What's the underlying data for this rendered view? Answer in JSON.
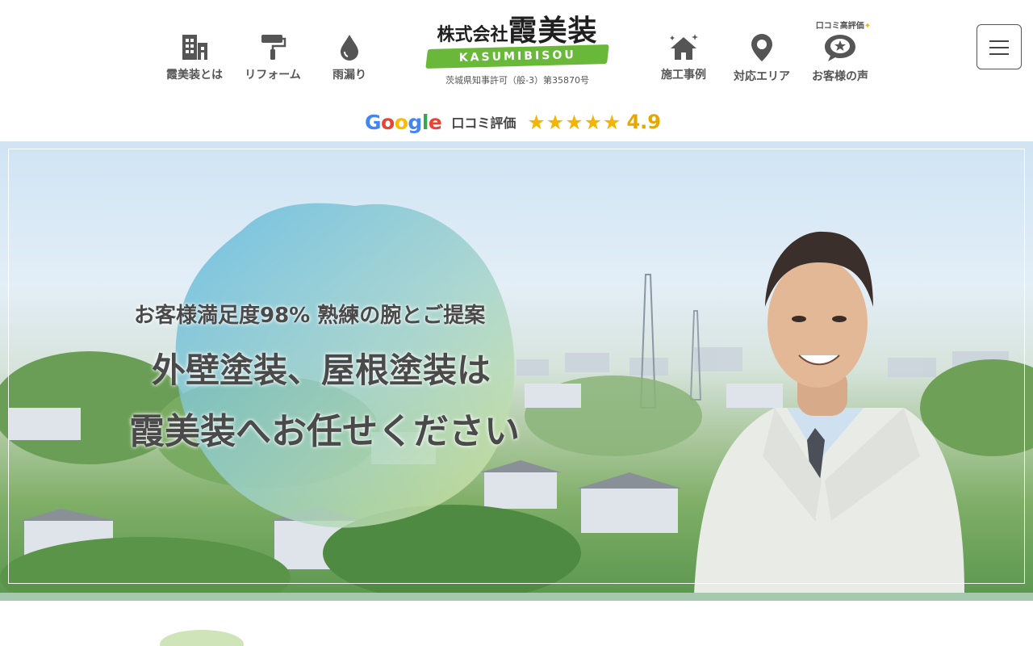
{
  "nav_left": [
    {
      "label": "霞美装とは",
      "icon": "building-icon"
    },
    {
      "label": "リフォーム",
      "icon": "paint-roller-icon"
    },
    {
      "label": "雨漏り",
      "icon": "water-drop-icon"
    }
  ],
  "nav_right": [
    {
      "label": "施工事例",
      "icon": "house-sparkle-icon"
    },
    {
      "label": "対応エリア",
      "icon": "map-pin-icon"
    },
    {
      "label": "お客様の声",
      "icon": "speech-bubble-star-icon"
    }
  ],
  "review_tag": "口コミ高評価",
  "logo": {
    "prefix": "株式会社",
    "name": "霞美装",
    "romaji": "KASUMIBISOU",
    "license": "茨城県知事許可（般-3）第35870号"
  },
  "rating": {
    "brand": [
      "G",
      "o",
      "o",
      "g",
      "l",
      "e"
    ],
    "label": "口コミ評価",
    "stars": "★★★★★",
    "score": "4.9"
  },
  "hero": {
    "sub": "お客様満足度98% 熟練の腕とご提案",
    "main1": "外壁塗装、屋根塗装は",
    "main2_em": "霞美装",
    "main2_rest": "へお任せください"
  },
  "colors": {
    "google": [
      "#4285f4",
      "#ea4335",
      "#fbbc05",
      "#4285f4",
      "#34a853",
      "#ea4335"
    ],
    "accent_green": "#6ab83a",
    "star": "#f5b400"
  }
}
